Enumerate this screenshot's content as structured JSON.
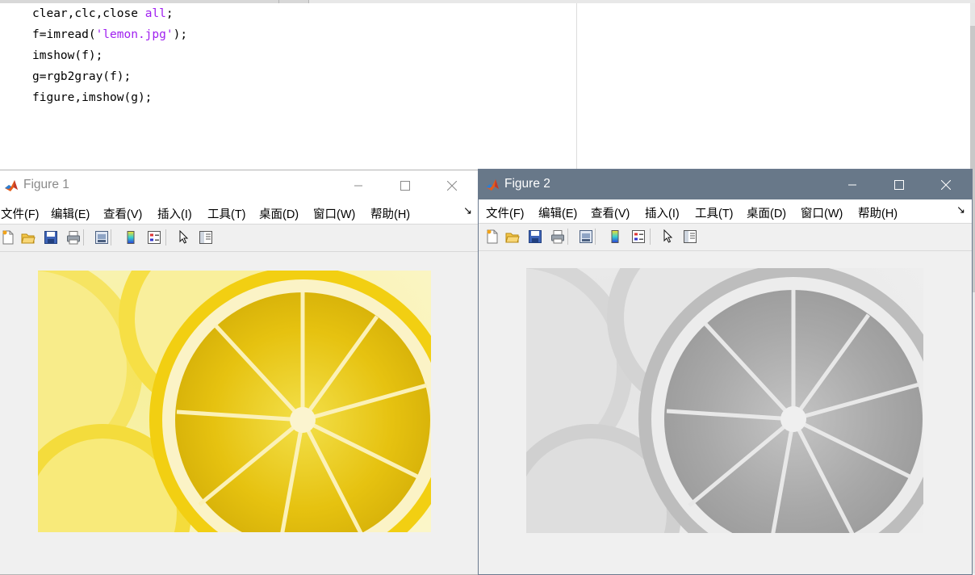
{
  "editor": {
    "code_lines": [
      {
        "pre": "clear,clc,close ",
        "kw": "all",
        "post": ";"
      },
      {
        "pre": "f=imread(",
        "kw": "'lemon.jpg'",
        "post": ");"
      },
      {
        "pre": "imshow(f);",
        "kw": "",
        "post": ""
      },
      {
        "pre": "g=rgb2gray(f);",
        "kw": "",
        "post": ""
      },
      {
        "pre": "figure,imshow(g);",
        "kw": "",
        "post": ""
      }
    ],
    "keyword_color": "#a020f0"
  },
  "figures": [
    {
      "title": "Figure 1",
      "active": false,
      "titlebar_color": "#ffffff",
      "image_kind": "color",
      "image_desc": "lemon.jpg"
    },
    {
      "title": "Figure 2",
      "active": true,
      "titlebar_color": "#687889",
      "image_kind": "grayscale",
      "image_desc": "rgb2gray(f)"
    }
  ],
  "menu": [
    "文件(F)",
    "编辑(E)",
    "查看(V)",
    "插入(I)",
    "工具(T)",
    "桌面(D)",
    "窗口(W)",
    "帮助(H)"
  ],
  "toolbar_icons": [
    "new-figure-icon",
    "open-file-icon",
    "save-icon",
    "print-icon",
    "print-preview-icon",
    "colorbar-icon",
    "legend-icon",
    "pointer-icon",
    "property-inspector-icon"
  ]
}
